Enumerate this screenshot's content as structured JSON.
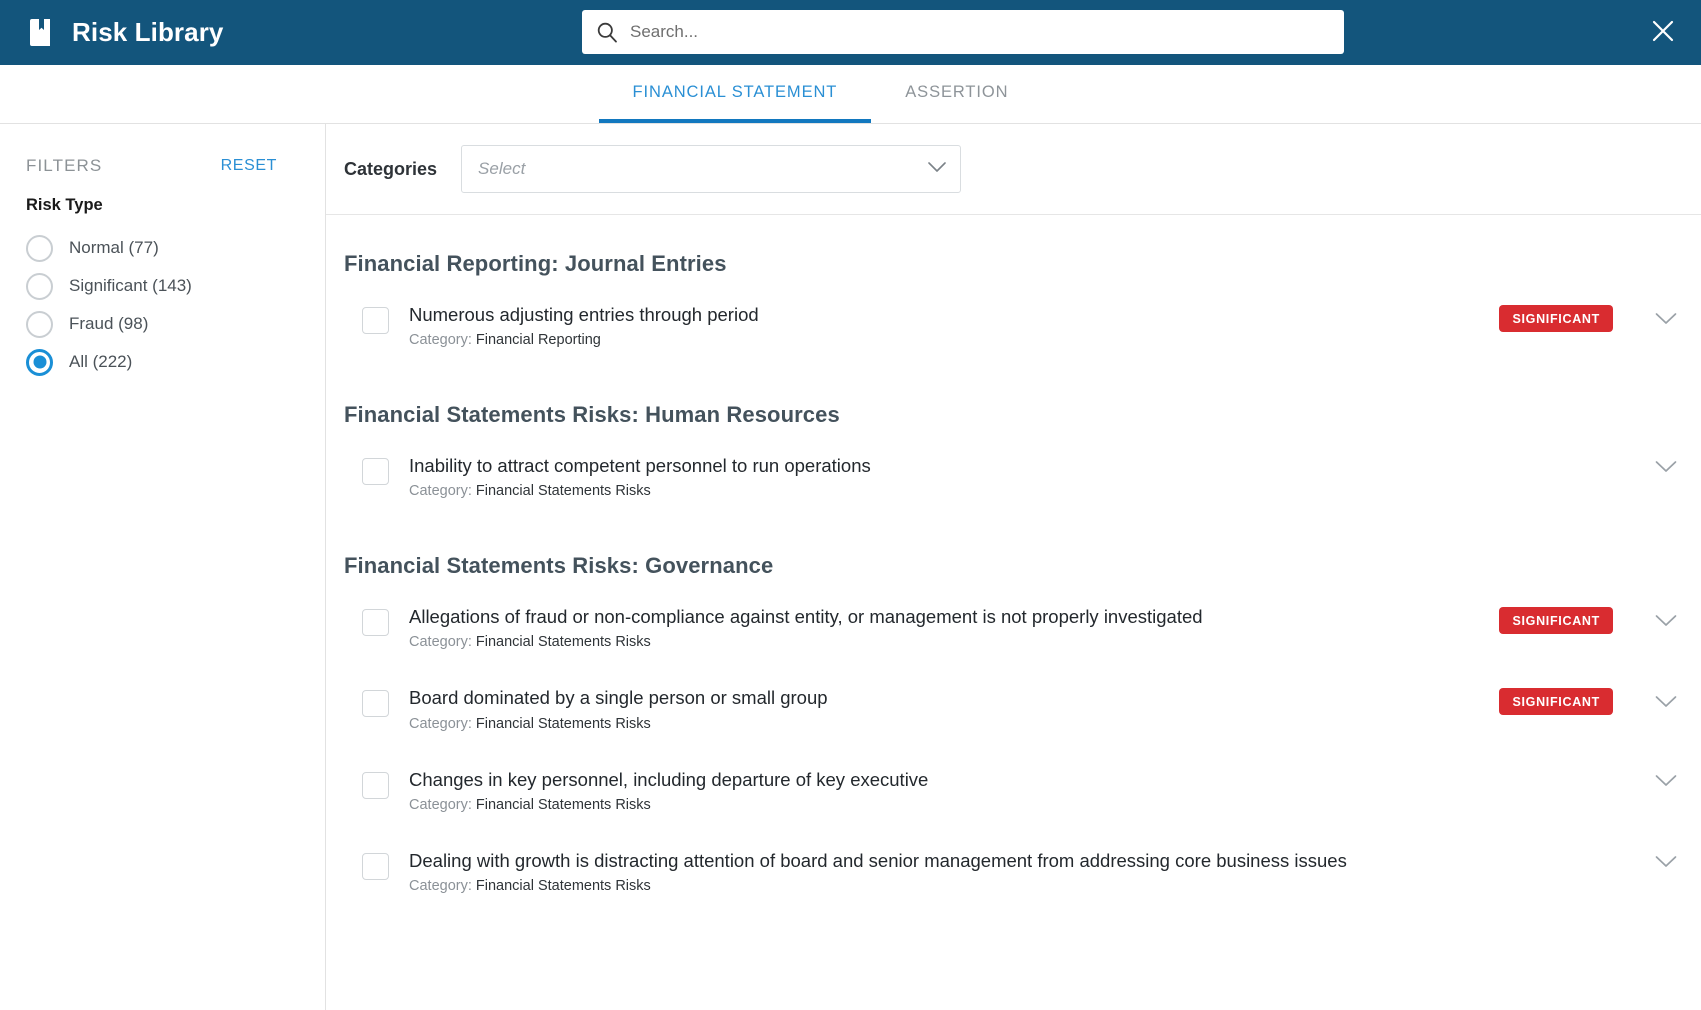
{
  "header": {
    "app_title": "Risk Library",
    "book_icon": "book-icon",
    "search_placeholder": "Search...",
    "search_value": "",
    "search_icon": "search-icon",
    "close_icon": "close-icon",
    "bar_color": "#13557c"
  },
  "tabs": [
    {
      "label": "FINANCIAL STATEMENT",
      "active": true
    },
    {
      "label": "ASSERTION",
      "active": false
    }
  ],
  "sidebar": {
    "filters_label": "FILTERS",
    "reset_label": "RESET",
    "section_title": "Risk Type",
    "options": [
      {
        "label": "Normal (77)",
        "selected": false
      },
      {
        "label": "Significant (143)",
        "selected": false
      },
      {
        "label": "Fraud (98)",
        "selected": false
      },
      {
        "label": "All (222)",
        "selected": true
      }
    ],
    "accent_color": "#1a8fd6"
  },
  "main": {
    "categories_label": "Categories",
    "categories_placeholder": "Select",
    "categories_value": "",
    "dropdown_icon": "chevron-down-icon",
    "groups": [
      {
        "title": "Financial Reporting: Journal Entries",
        "rows": [
          {
            "title": "Numerous adjusting entries through period",
            "category_label": "Category:",
            "category_value": "Financial Reporting",
            "badge": "SIGNIFICANT",
            "checked": false
          }
        ]
      },
      {
        "title": "Financial Statements Risks: Human Resources",
        "rows": [
          {
            "title": "Inability to attract competent personnel to run operations",
            "category_label": "Category:",
            "category_value": "Financial Statements Risks",
            "badge": "",
            "checked": false
          }
        ]
      },
      {
        "title": "Financial Statements Risks: Governance",
        "rows": [
          {
            "title": "Allegations of fraud or non-compliance against entity, or management is not properly investigated",
            "category_label": "Category:",
            "category_value": "Financial Statements Risks",
            "badge": "SIGNIFICANT",
            "checked": false
          },
          {
            "title": "Board dominated by a single person or small group",
            "category_label": "Category:",
            "category_value": "Financial Statements Risks",
            "badge": "SIGNIFICANT",
            "checked": false
          },
          {
            "title": "Changes in key personnel, including departure of key executive",
            "category_label": "Category:",
            "category_value": "Financial Statements Risks",
            "badge": "",
            "checked": false
          },
          {
            "title": "Dealing with growth is distracting attention of board and senior management from addressing core business issues",
            "category_label": "Category:",
            "category_value": "Financial Statements Risks",
            "badge": "",
            "checked": false
          }
        ]
      }
    ],
    "badge_color": "#d92c30",
    "row_chevron_icon": "chevron-down-icon"
  }
}
